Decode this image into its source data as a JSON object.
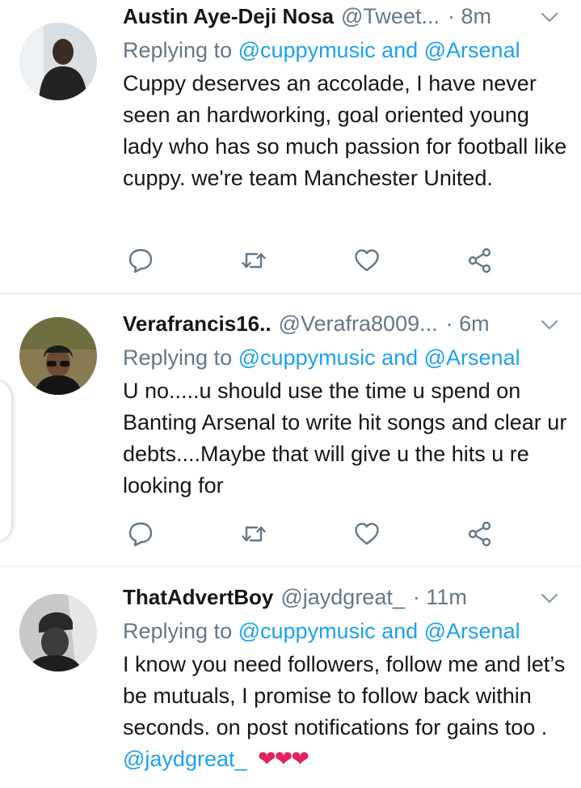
{
  "tweets": [
    {
      "name": "Austin Aye-Deji Nosa",
      "handle": "@Tweet...",
      "time": "· 8m",
      "reply_prefix": "Replying to",
      "reply_mentions": "@cuppymusic and @Arsenal",
      "text": "Cuppy deserves an accolade, I have never seen an hardworking, goal oriented young lady who has so much passion for football like cuppy. we're team Manchester United."
    },
    {
      "name": "Verafrancis16..",
      "handle": "@Verafra8009...",
      "time": "· 6m",
      "reply_prefix": "Replying to",
      "reply_mentions": "@cuppymusic and @Arsenal",
      "text": "U no.....u should use the time u spend on Banting Arsenal to write hit songs and clear ur debts....Maybe that will give u the hits u re looking for"
    },
    {
      "name": "ThatAdvertBoy",
      "handle": "@jaydgreat_",
      "time": "· 11m",
      "reply_prefix": "Replying to",
      "reply_mentions": "@cuppymusic and @Arsenal",
      "text": "I know you need followers, follow me and let’s be mutuals, I promise to follow back within seconds. on post notifications for gains too .",
      "text_mention": "@jaydgreat_",
      "text_emoji": "❤❤❤"
    }
  ],
  "icons": {
    "reply": "reply-icon",
    "retweet": "retweet-icon",
    "like": "heart-icon",
    "share": "share-icon",
    "more": "chevron-down-icon"
  },
  "colors": {
    "accent": "#1da1f2",
    "muted": "#657786",
    "text": "#14171a",
    "divider": "#e1e8ed",
    "heart": "#e0245e"
  }
}
